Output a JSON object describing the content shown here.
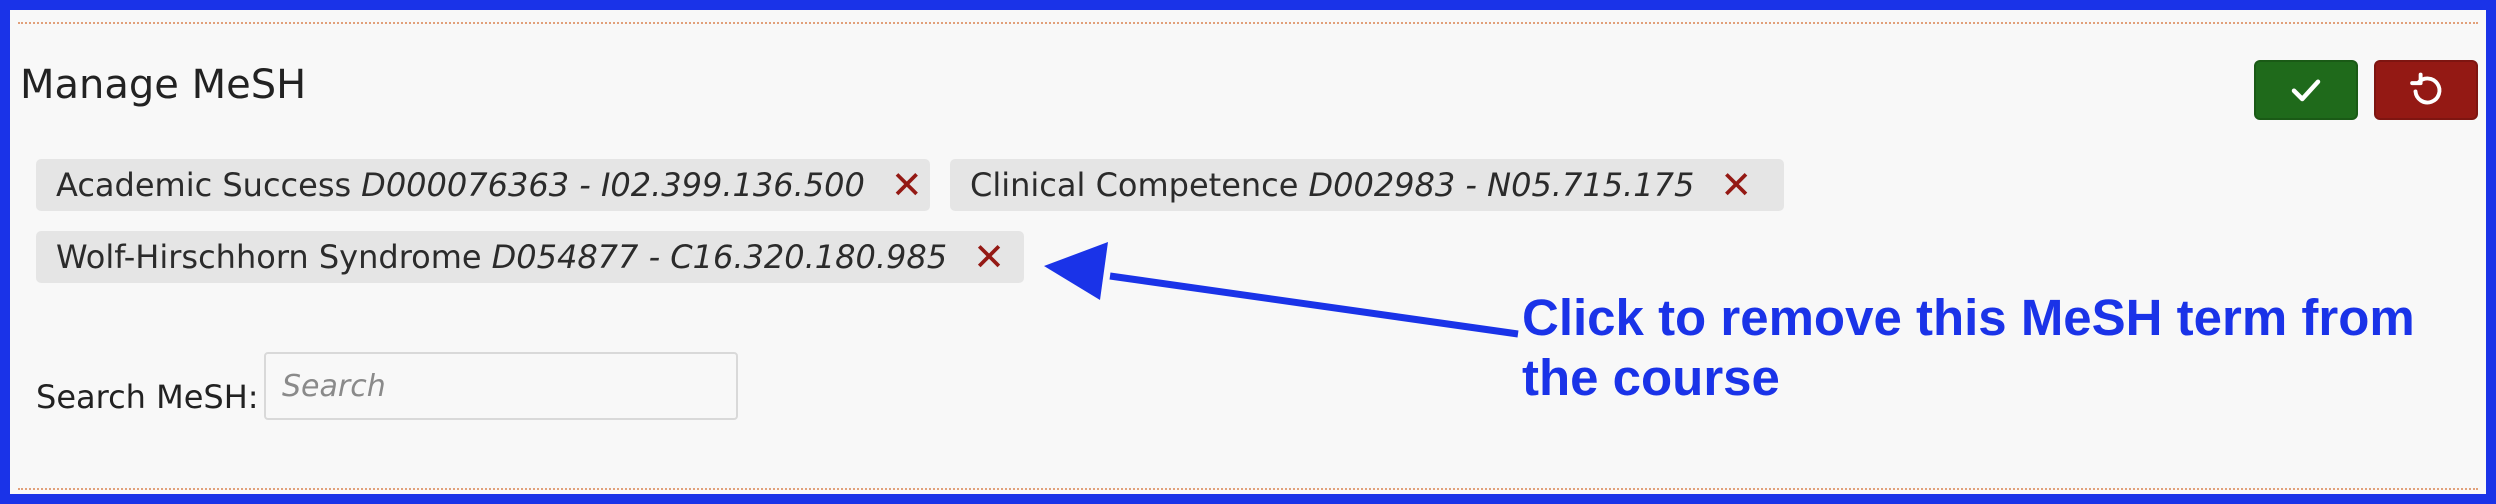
{
  "page_title": "Manage MeSH",
  "actions": {
    "save_icon": "check-icon",
    "reset_icon": "undo-icon",
    "save_color": "#1f6a1b",
    "reset_color": "#941914"
  },
  "mesh_terms": [
    {
      "term": "Academic Success",
      "code": "D000076363 - I02.399.136.500",
      "remove_symbol": "✕"
    },
    {
      "term": "Clinical Competence",
      "code": "D002983 - N05.715.175",
      "remove_symbol": "✕"
    },
    {
      "term": "Wolf-Hirschhorn Syndrome",
      "code": "D054877 - C16.320.180.985",
      "remove_symbol": "✕"
    }
  ],
  "search": {
    "label": "Search MeSH:",
    "placeholder": "Search",
    "value": ""
  },
  "annotation": {
    "text": "Click to remove this MeSH term from the course",
    "color": "#1a33e8"
  }
}
